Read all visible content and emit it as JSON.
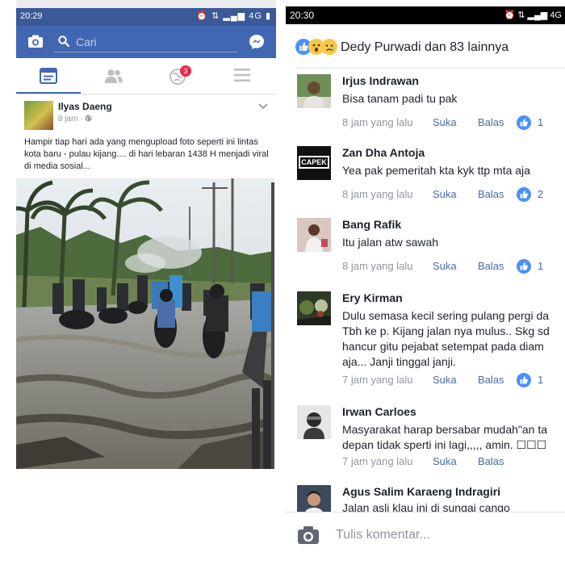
{
  "left_screen": {
    "status_bar": {
      "time": "20:29",
      "network": "4G"
    },
    "search": {
      "placeholder": "Cari"
    },
    "notifications_badge": "3",
    "post": {
      "author": "Ilyas Daeng",
      "time": "8 jam",
      "text": "Hampir tiap hari ada yang mengupload foto seperti ini lintas kota baru - pulau kijang.... di hari lebaran 1438 H menjadi viral di media sosial..."
    }
  },
  "right_screen": {
    "status_bar": {
      "time": "20:30",
      "network": "4G"
    },
    "reactions_summary": "Dedy Purwadi dan 83 lainnya",
    "comments": [
      {
        "name": "Irjus Indrawan",
        "lines": [
          "Bisa tanam padi tu pak"
        ],
        "time": "8 jam yang lalu",
        "like": "Suka",
        "reply": "Balas",
        "likes": "1"
      },
      {
        "name": "Zan Dha Antoja",
        "avatar_text": "CAPEK",
        "lines": [
          "Yea pak pemeritah kta kyk ttp mta aja"
        ],
        "time": "8 jam yang lalu",
        "like": "Suka",
        "reply": "Balas",
        "likes": "2"
      },
      {
        "name": "Bang Rafik",
        "lines": [
          "Itu jalan atw sawah"
        ],
        "time": "8 jam yang lalu",
        "like": "Suka",
        "reply": "Balas",
        "likes": "1"
      },
      {
        "name": "Ery Kirman",
        "lines": [
          "Dulu semasa kecil sering pulang pergi da",
          "Tbh ke p. Kijang jalan nya mulus.. Skg sd",
          "hancur gitu pejabat setempat pada diam",
          "aja... Janji tinggal janji."
        ],
        "time": "7 jam yang lalu",
        "like": "Suka",
        "reply": "Balas",
        "likes": "1"
      },
      {
        "name": "Irwan Carloes",
        "lines": [
          "Masyarakat harap bersabar mudah\"an ta",
          "depan tidak sperti ini lagi,,,,, amin. ☐☐☐"
        ],
        "time": "7 jam yang lalu",
        "like": "Suka",
        "reply": "Balas",
        "likes": ""
      },
      {
        "name": "Agus Salim Karaeng Indragiri",
        "lines": [
          "Jalan asli klau ini di sungai cango"
        ],
        "time": "",
        "like": "",
        "reply": "",
        "likes": ""
      }
    ],
    "compose": {
      "placeholder": "Tulis komentar..."
    }
  },
  "colors": {
    "facebook_blue": "#4267b2",
    "status_blue": "#3b5998",
    "like_blue": "#4a90ff",
    "notif_red": "#f02849"
  },
  "icons": [
    "camera-icon",
    "search-icon",
    "messenger-icon",
    "news-feed-icon",
    "friends-icon",
    "notifications-icon",
    "menu-icon",
    "globe-icon",
    "chevron-down-icon",
    "like-reaction-icon",
    "wow-reaction-icon",
    "sad-reaction-icon"
  ]
}
